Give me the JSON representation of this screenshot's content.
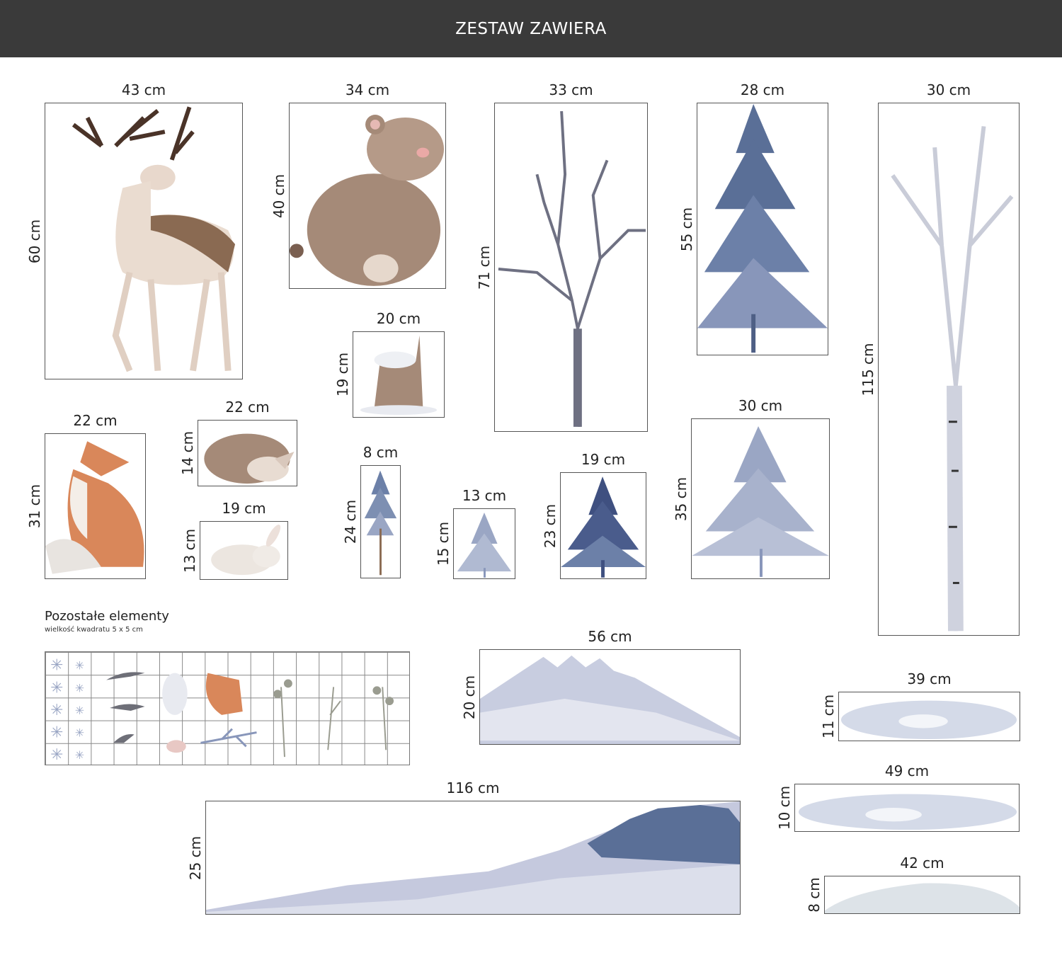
{
  "header": {
    "title": "ZESTAW ZAWIERA"
  },
  "items": [
    {
      "name": "deer",
      "width": "43 cm",
      "height": "60 cm"
    },
    {
      "name": "bear",
      "width": "34 cm",
      "height": "40 cm"
    },
    {
      "name": "bare-tree",
      "width": "33 cm",
      "height": "71 cm"
    },
    {
      "name": "spruce",
      "width": "28 cm",
      "height": "55 cm"
    },
    {
      "name": "birch",
      "width": "30 cm",
      "height": "115 cm"
    },
    {
      "name": "stump",
      "width": "20 cm",
      "height": "19 cm"
    },
    {
      "name": "fox",
      "width": "22 cm",
      "height": "31 cm"
    },
    {
      "name": "fawn",
      "width": "22 cm",
      "height": "14 cm"
    },
    {
      "name": "rabbit",
      "width": "19 cm",
      "height": "13 cm"
    },
    {
      "name": "tiny-tree",
      "width": "8 cm",
      "height": "24 cm"
    },
    {
      "name": "small-tree",
      "width": "13 cm",
      "height": "15 cm"
    },
    {
      "name": "dark-tree",
      "width": "19 cm",
      "height": "23 cm"
    },
    {
      "name": "pale-tree",
      "width": "30 cm",
      "height": "35 cm"
    },
    {
      "name": "hill-medium",
      "width": "56 cm",
      "height": "20 cm"
    },
    {
      "name": "hill-large",
      "width": "116 cm",
      "height": "25 cm"
    },
    {
      "name": "snow-1",
      "width": "39 cm",
      "height": "11 cm"
    },
    {
      "name": "snow-2",
      "width": "49 cm",
      "height": "10 cm"
    },
    {
      "name": "snow-3",
      "width": "42 cm",
      "height": "8 cm"
    }
  ],
  "other": {
    "title": "Pozostałe elementy",
    "subtitle": "wielkość kwadratu 5 x 5 cm"
  },
  "colors": {
    "header_bg": "#3a3a3a",
    "tree_blue": "#5a6f97",
    "pale_blue": "#9aa6c4",
    "fox": "#d9875a",
    "deer": "#8a6a52"
  }
}
